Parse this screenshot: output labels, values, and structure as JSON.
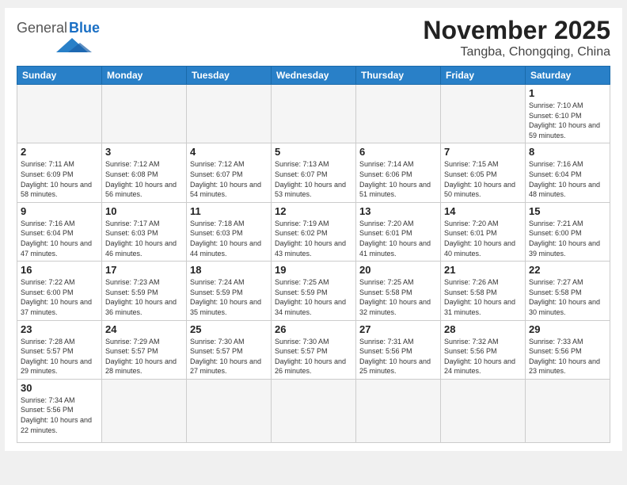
{
  "header": {
    "logo_general": "General",
    "logo_blue": "Blue",
    "month_title": "November 2025",
    "location": "Tangba, Chongqing, China"
  },
  "weekdays": [
    "Sunday",
    "Monday",
    "Tuesday",
    "Wednesday",
    "Thursday",
    "Friday",
    "Saturday"
  ],
  "weeks": [
    [
      {
        "day": "",
        "empty": true
      },
      {
        "day": "",
        "empty": true
      },
      {
        "day": "",
        "empty": true
      },
      {
        "day": "",
        "empty": true
      },
      {
        "day": "",
        "empty": true
      },
      {
        "day": "",
        "empty": true
      },
      {
        "day": "1",
        "sunrise": "7:10 AM",
        "sunset": "6:10 PM",
        "daylight": "10 hours and 59 minutes."
      }
    ],
    [
      {
        "day": "2",
        "sunrise": "7:11 AM",
        "sunset": "6:09 PM",
        "daylight": "10 hours and 58 minutes."
      },
      {
        "day": "3",
        "sunrise": "7:12 AM",
        "sunset": "6:08 PM",
        "daylight": "10 hours and 56 minutes."
      },
      {
        "day": "4",
        "sunrise": "7:12 AM",
        "sunset": "6:07 PM",
        "daylight": "10 hours and 54 minutes."
      },
      {
        "day": "5",
        "sunrise": "7:13 AM",
        "sunset": "6:07 PM",
        "daylight": "10 hours and 53 minutes."
      },
      {
        "day": "6",
        "sunrise": "7:14 AM",
        "sunset": "6:06 PM",
        "daylight": "10 hours and 51 minutes."
      },
      {
        "day": "7",
        "sunrise": "7:15 AM",
        "sunset": "6:05 PM",
        "daylight": "10 hours and 50 minutes."
      },
      {
        "day": "8",
        "sunrise": "7:16 AM",
        "sunset": "6:04 PM",
        "daylight": "10 hours and 48 minutes."
      }
    ],
    [
      {
        "day": "9",
        "sunrise": "7:16 AM",
        "sunset": "6:04 PM",
        "daylight": "10 hours and 47 minutes."
      },
      {
        "day": "10",
        "sunrise": "7:17 AM",
        "sunset": "6:03 PM",
        "daylight": "10 hours and 46 minutes."
      },
      {
        "day": "11",
        "sunrise": "7:18 AM",
        "sunset": "6:03 PM",
        "daylight": "10 hours and 44 minutes."
      },
      {
        "day": "12",
        "sunrise": "7:19 AM",
        "sunset": "6:02 PM",
        "daylight": "10 hours and 43 minutes."
      },
      {
        "day": "13",
        "sunrise": "7:20 AM",
        "sunset": "6:01 PM",
        "daylight": "10 hours and 41 minutes."
      },
      {
        "day": "14",
        "sunrise": "7:20 AM",
        "sunset": "6:01 PM",
        "daylight": "10 hours and 40 minutes."
      },
      {
        "day": "15",
        "sunrise": "7:21 AM",
        "sunset": "6:00 PM",
        "daylight": "10 hours and 39 minutes."
      }
    ],
    [
      {
        "day": "16",
        "sunrise": "7:22 AM",
        "sunset": "6:00 PM",
        "daylight": "10 hours and 37 minutes."
      },
      {
        "day": "17",
        "sunrise": "7:23 AM",
        "sunset": "5:59 PM",
        "daylight": "10 hours and 36 minutes."
      },
      {
        "day": "18",
        "sunrise": "7:24 AM",
        "sunset": "5:59 PM",
        "daylight": "10 hours and 35 minutes."
      },
      {
        "day": "19",
        "sunrise": "7:25 AM",
        "sunset": "5:59 PM",
        "daylight": "10 hours and 34 minutes."
      },
      {
        "day": "20",
        "sunrise": "7:25 AM",
        "sunset": "5:58 PM",
        "daylight": "10 hours and 32 minutes."
      },
      {
        "day": "21",
        "sunrise": "7:26 AM",
        "sunset": "5:58 PM",
        "daylight": "10 hours and 31 minutes."
      },
      {
        "day": "22",
        "sunrise": "7:27 AM",
        "sunset": "5:58 PM",
        "daylight": "10 hours and 30 minutes."
      }
    ],
    [
      {
        "day": "23",
        "sunrise": "7:28 AM",
        "sunset": "5:57 PM",
        "daylight": "10 hours and 29 minutes."
      },
      {
        "day": "24",
        "sunrise": "7:29 AM",
        "sunset": "5:57 PM",
        "daylight": "10 hours and 28 minutes."
      },
      {
        "day": "25",
        "sunrise": "7:30 AM",
        "sunset": "5:57 PM",
        "daylight": "10 hours and 27 minutes."
      },
      {
        "day": "26",
        "sunrise": "7:30 AM",
        "sunset": "5:57 PM",
        "daylight": "10 hours and 26 minutes."
      },
      {
        "day": "27",
        "sunrise": "7:31 AM",
        "sunset": "5:56 PM",
        "daylight": "10 hours and 25 minutes."
      },
      {
        "day": "28",
        "sunrise": "7:32 AM",
        "sunset": "5:56 PM",
        "daylight": "10 hours and 24 minutes."
      },
      {
        "day": "29",
        "sunrise": "7:33 AM",
        "sunset": "5:56 PM",
        "daylight": "10 hours and 23 minutes."
      }
    ],
    [
      {
        "day": "30",
        "sunrise": "7:34 AM",
        "sunset": "5:56 PM",
        "daylight": "10 hours and 22 minutes."
      },
      {
        "day": "",
        "empty": true
      },
      {
        "day": "",
        "empty": true
      },
      {
        "day": "",
        "empty": true
      },
      {
        "day": "",
        "empty": true
      },
      {
        "day": "",
        "empty": true
      },
      {
        "day": "",
        "empty": true
      }
    ]
  ]
}
